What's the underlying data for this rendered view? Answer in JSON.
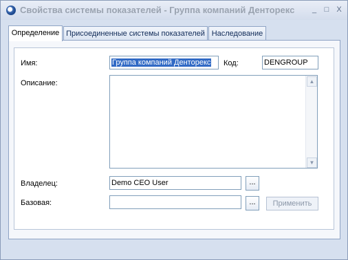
{
  "window": {
    "title": "Свойства системы показателей - Группа компаний Денторекс",
    "minimize_glyph": "_",
    "maximize_glyph": "□",
    "close_glyph": "X"
  },
  "tabs": [
    {
      "label": "Определение",
      "active": true
    },
    {
      "label": "Присоединенные системы показателей",
      "active": false
    },
    {
      "label": "Наследование",
      "active": false
    }
  ],
  "form": {
    "name_label": "Имя:",
    "name_value": "Группа компаний Денторекс",
    "code_label": "Код:",
    "code_value": "DENGROUP",
    "description_label": "Описание:",
    "description_value": "",
    "owner_label": "Владелец:",
    "owner_value": "Demo CEO User",
    "base_label": "Базовая:",
    "base_value": "",
    "browse_label": "...",
    "apply_label": "Применить"
  },
  "colors": {
    "selection": "#316ac5",
    "frame": "#d6e0ef",
    "title_text": "#9aa3b0"
  }
}
